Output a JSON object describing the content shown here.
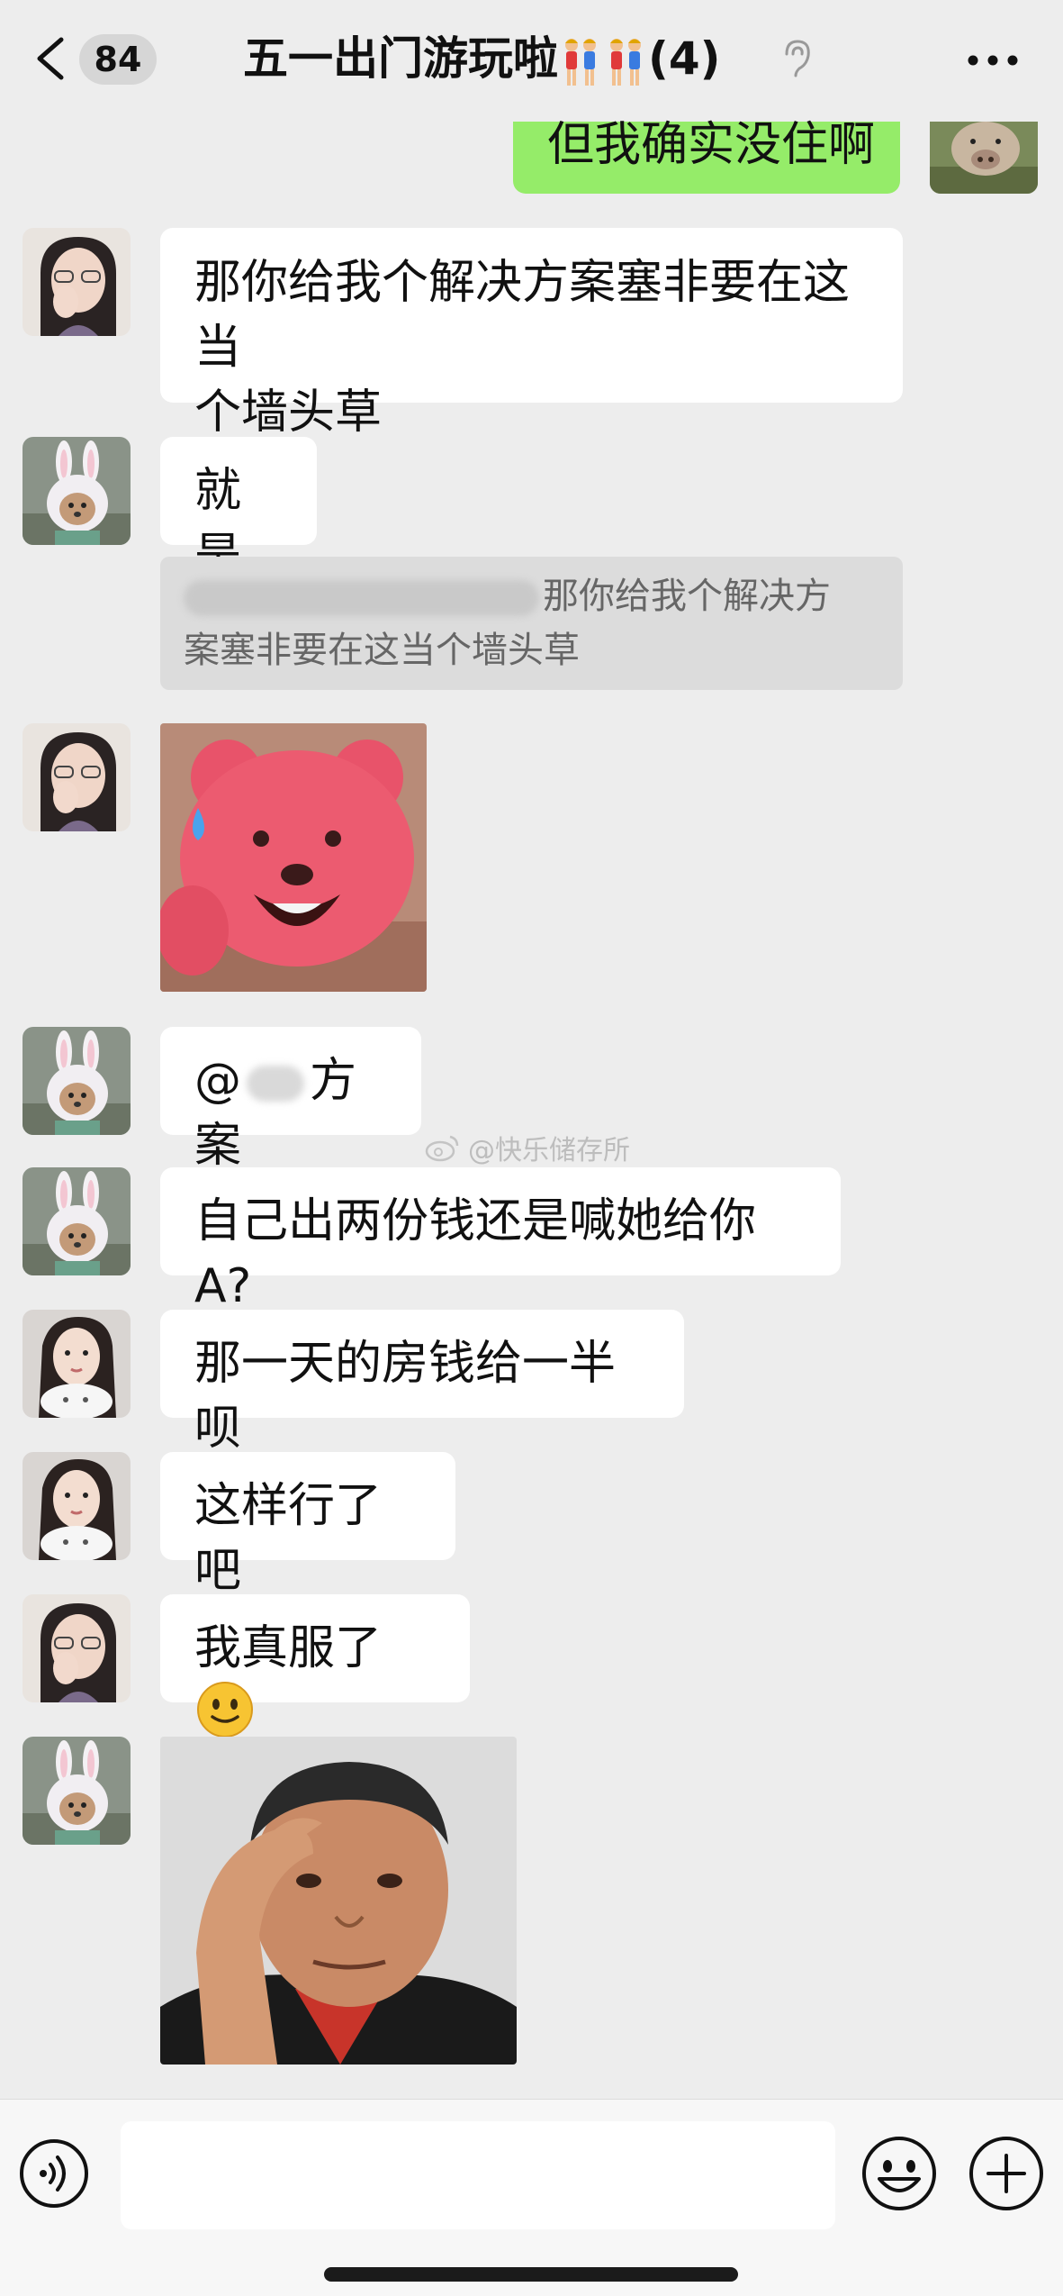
{
  "header": {
    "unread_count": "84",
    "title_text": "五一出门游玩啦",
    "member_count": "(4)"
  },
  "messages": [
    {
      "sender": "me",
      "text": "但我确实没住啊"
    },
    {
      "sender": "girl-glasses",
      "text": "那你给我个解决方案塞非要在这当\n个墙头草"
    },
    {
      "sender": "bunny-hat",
      "text": "就是"
    },
    {
      "sender": "bunny-hat",
      "quote_text": "那你给我个解决方\n案塞非要在这当个墙头草"
    },
    {
      "sender": "girl-glasses",
      "sticker": "pink-bear-sweat-sticker"
    },
    {
      "sender": "bunny-hat",
      "text_prefix": "@",
      "text_suffix": "方案"
    },
    {
      "sender": "bunny-hat",
      "text": "自己出两份钱还是喊她给你 A?"
    },
    {
      "sender": "girl-cat",
      "text": "那一天的房钱给一半呗"
    },
    {
      "sender": "girl-cat",
      "text": "这样行了吧"
    },
    {
      "sender": "girl-glasses",
      "text": "我真服了",
      "emoji": "smile-emoji"
    },
    {
      "sender": "bunny-hat",
      "sticker": "man-scratching-head-sticker"
    }
  ],
  "watermark": "@快乐储存所",
  "colors": {
    "background": "#ededed",
    "my_bubble": "#95ec69",
    "their_bubble": "#ffffff"
  }
}
